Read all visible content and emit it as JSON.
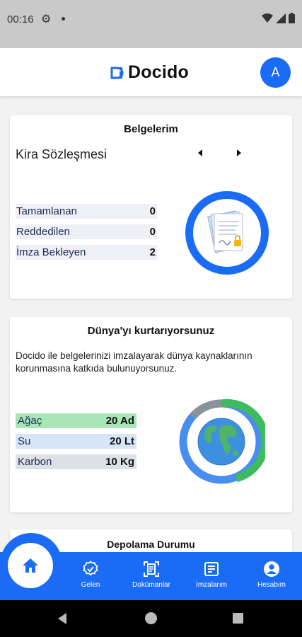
{
  "statusbar": {
    "time": "00:16"
  },
  "appbar": {
    "brand": "Docido",
    "avatar_initial": "A"
  },
  "documents_card": {
    "title": "Belgelerim",
    "document_name": "Kira Sözleşmesi",
    "stats": [
      {
        "label": "Tamamlanan",
        "value": "0"
      },
      {
        "label": "Reddedilen",
        "value": "0"
      },
      {
        "label": "İmza Bekleyen",
        "value": "2"
      }
    ]
  },
  "environment_card": {
    "title": "Dünya'yı kurtarıyorsunuz",
    "description": "Docido ile belgelerinizi imzalayarak dünya kaynaklarının korunmasına katkıda bulunuyorsunuz.",
    "stats": [
      {
        "label": "Ağaç",
        "value": "20 Ad",
        "color": "#a8e6b8"
      },
      {
        "label": "Su",
        "value": "20 Lt",
        "color": "#d6e6f7"
      },
      {
        "label": "Karbon",
        "value": "10 Kg",
        "color": "#dde0e5"
      }
    ],
    "ring_colors": {
      "tree": "#3dbb5d",
      "water": "#4a8df0",
      "carbon": "#8a9299"
    }
  },
  "storage_card": {
    "title": "Depolama Durumu"
  },
  "bottom_nav": {
    "items": [
      {
        "label": "Gelen",
        "icon": "check-badge-icon"
      },
      {
        "label": "Dokümanlar",
        "icon": "document-scan-icon"
      },
      {
        "label": "İmzalarım",
        "icon": "signature-list-icon"
      },
      {
        "label": "Hesabım",
        "icon": "account-circle-icon"
      }
    ],
    "home_icon": "home-icon"
  },
  "colors": {
    "brand": "#1a6bf5"
  }
}
